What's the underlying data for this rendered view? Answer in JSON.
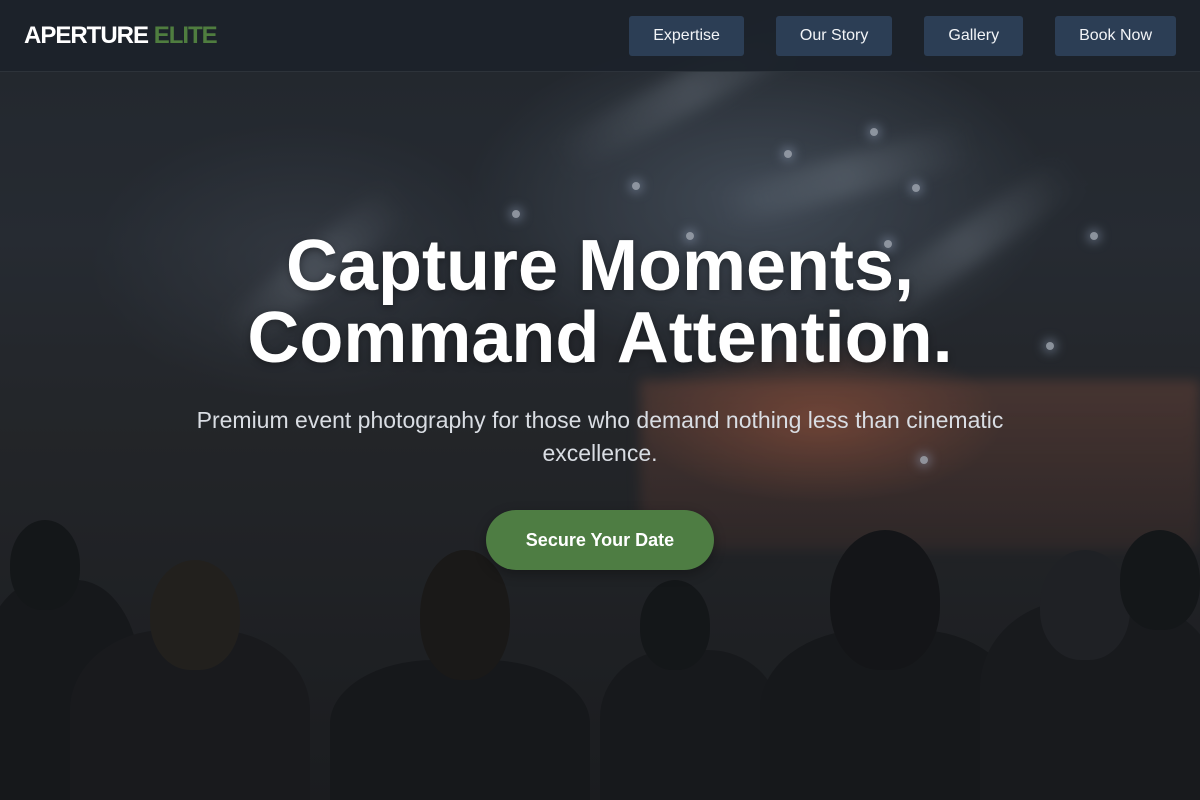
{
  "brand": {
    "name_primary": "APERTURE",
    "name_accent": "ELITE",
    "accent_color": "#4f7d3f"
  },
  "nav": {
    "items": [
      {
        "label": "Expertise"
      },
      {
        "label": "Our Story"
      },
      {
        "label": "Gallery"
      },
      {
        "label": "Book Now"
      }
    ],
    "button_color": "#2c3e55"
  },
  "hero": {
    "headline_line1": "Capture Moments,",
    "headline_line2": "Command Attention.",
    "subheadline": "Premium event photography for those who demand nothing less than cinematic excellence.",
    "cta_label": "Secure Your Date",
    "cta_color": "#4e7d43",
    "background": "concert-crowd-photo"
  }
}
